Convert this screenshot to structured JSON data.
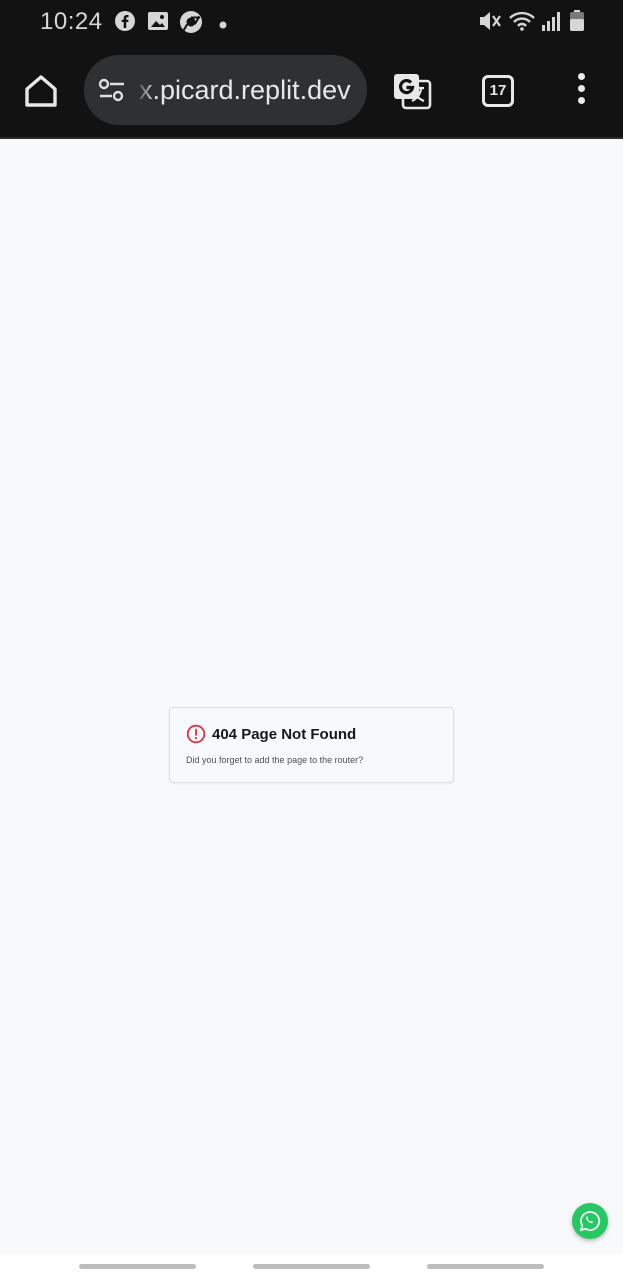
{
  "status_bar": {
    "time": "10:24",
    "left_icons": [
      "facebook-icon",
      "gallery-icon",
      "chrome-badge-icon",
      "dot-icon"
    ],
    "right_icons": [
      "mute-icon",
      "wifi-icon",
      "signal-icon",
      "battery-icon"
    ]
  },
  "browser": {
    "url": "x.picard.replit.dev",
    "tab_count": "17",
    "icons": [
      "home-icon",
      "site-settings-icon",
      "translate-icon",
      "more-vert-icon"
    ]
  },
  "page": {
    "error_title": "404 Page Not Found",
    "error_description": "Did you forget to add the page to the router?",
    "colors": {
      "alert": "#dc3545",
      "whatsapp": "#25c863"
    }
  }
}
